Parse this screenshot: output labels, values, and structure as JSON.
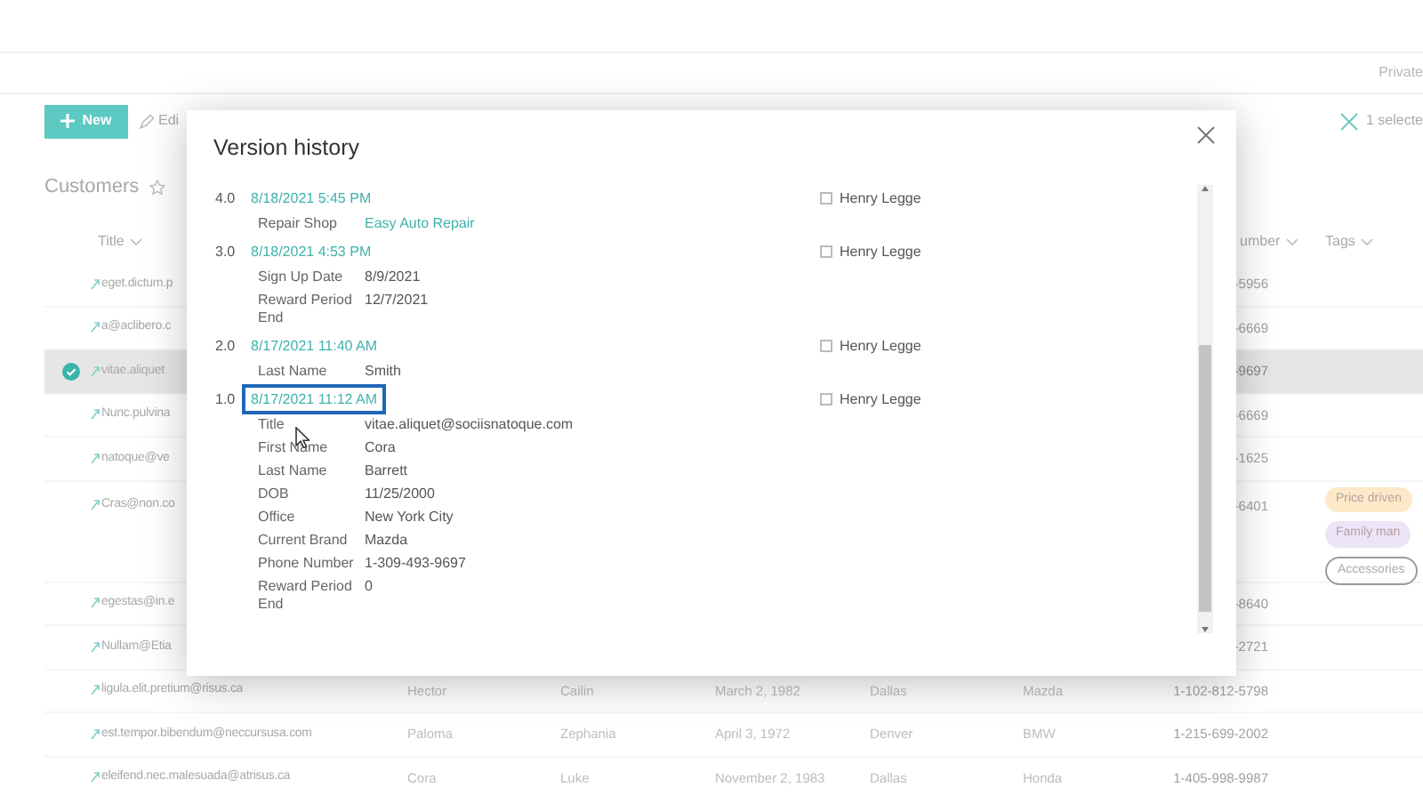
{
  "top_bar": {
    "privacy": "Private"
  },
  "command_bar": {
    "new_button": "New",
    "edit_button": "Edi",
    "selection": "1 selecte"
  },
  "list": {
    "title": "Customers",
    "columns": [
      {
        "label": "Title"
      },
      {
        "label": "umber"
      },
      {
        "label": "Tags"
      }
    ],
    "rows": [
      {
        "selected": false,
        "tall": false,
        "title": "eget.dictum.p",
        "phone": "-5956"
      },
      {
        "selected": false,
        "tall": false,
        "title": "a@aclibero.c",
        "phone": "-6669"
      },
      {
        "selected": true,
        "tall": false,
        "title": "vitae.aliquet",
        "phone": "-9697"
      },
      {
        "selected": false,
        "tall": false,
        "title": "Nunc.pulvina",
        "phone": "-6669"
      },
      {
        "selected": false,
        "tall": false,
        "title": "natoque@ve",
        "phone": "-1625"
      },
      {
        "selected": false,
        "tall": true,
        "title": "Cras@non.co",
        "phone": "-6401",
        "tags": [
          {
            "label": "Price driven",
            "kind": "filled",
            "color": "#fde9c8"
          },
          {
            "label": "Family man",
            "kind": "filled",
            "color": "#ece4f7"
          },
          {
            "label": "Accessories",
            "kind": "outline",
            "color": "#9a9a9a"
          }
        ]
      },
      {
        "selected": false,
        "tall": false,
        "title": "egestas@in.e",
        "phone": "-8640"
      },
      {
        "selected": false,
        "tall": false,
        "title": "Nullam@Etia",
        "phone": "-2721"
      },
      {
        "selected": false,
        "tall": false,
        "title": "ligula.elit.pretium@risus.ca",
        "first_name": "Hector",
        "last_name": "Cailin",
        "dob": "March 2, 1982",
        "office": "Dallas",
        "brand": "Mazda",
        "phone": "1-102-812-5798"
      },
      {
        "selected": false,
        "tall": false,
        "title": "est.tempor.bibendum@neccursusa.com",
        "first_name": "Paloma",
        "last_name": "Zephania",
        "dob": "April 3, 1972",
        "office": "Denver",
        "brand": "BMW",
        "phone": "1-215-699-2002"
      },
      {
        "selected": false,
        "tall": false,
        "title": "eleifend.nec.malesuada@atrisus.ca",
        "first_name": "Cora",
        "last_name": "Luke",
        "dob": "November 2, 1983",
        "office": "Dallas",
        "brand": "Honda",
        "phone": "1-405-998-9987"
      }
    ]
  },
  "dialog": {
    "title": "Version history",
    "versions": [
      {
        "number": "4.0",
        "date": "8/18/2021 5:45 PM",
        "highlighted": false,
        "modified_by": "Henry Legge",
        "changes": [
          {
            "label": "Repair Shop",
            "value": "Easy Auto Repair",
            "kind": "link"
          }
        ]
      },
      {
        "number": "3.0",
        "date": "8/18/2021 4:53 PM",
        "highlighted": false,
        "modified_by": "Henry Legge",
        "changes": [
          {
            "label": "Sign Up Date",
            "value": "8/9/2021",
            "kind": "text"
          },
          {
            "label": "Reward Period End",
            "value": "12/7/2021",
            "kind": "text"
          }
        ]
      },
      {
        "number": "2.0",
        "date": "8/17/2021 11:40 AM",
        "highlighted": false,
        "modified_by": "Henry Legge",
        "changes": [
          {
            "label": "Last Name",
            "value": "Smith",
            "kind": "text"
          }
        ]
      },
      {
        "number": "1.0",
        "date": "8/17/2021 11:12 AM",
        "highlighted": true,
        "modified_by": "Henry Legge",
        "changes": [
          {
            "label": "Title",
            "value": "vitae.aliquet@sociisnatoque.com",
            "kind": "text"
          },
          {
            "label": "First Name",
            "value": "Cora",
            "kind": "text"
          },
          {
            "label": "Last Name",
            "value": "Barrett",
            "kind": "text"
          },
          {
            "label": "DOB",
            "value": "11/25/2000",
            "kind": "text"
          },
          {
            "label": "Office",
            "value": "New York City",
            "kind": "text"
          },
          {
            "label": "Current Brand",
            "value": "Mazda",
            "kind": "text"
          },
          {
            "label": "Phone Number",
            "value": "1-309-493-9697",
            "kind": "text"
          },
          {
            "label": "Reward Period End",
            "value": "0",
            "kind": "text"
          }
        ]
      }
    ]
  }
}
